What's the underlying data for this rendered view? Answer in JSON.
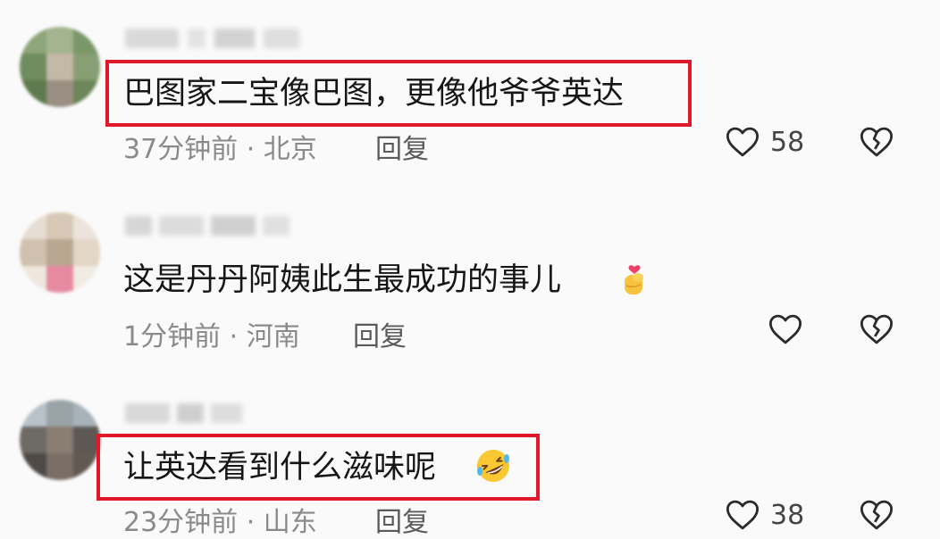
{
  "comments": [
    {
      "text": "巴图家二宝像巴图，更像他爷爷英达",
      "meta": "37分钟前 · 北京",
      "reply": "回复",
      "likes": "58",
      "highlighted": true,
      "emoji": null
    },
    {
      "text": "这是丹丹阿姨此生最成功的事儿",
      "meta": "1分钟前 · 河南",
      "reply": "回复",
      "likes": "",
      "highlighted": false,
      "emoji": "finger-heart-emoji"
    },
    {
      "text": "让英达看到什么滋味呢",
      "meta": "23分钟前 · 山东",
      "reply": "回复",
      "likes": "38",
      "highlighted": true,
      "emoji": "rolling-laughing-emoji"
    }
  ],
  "icons": {
    "like": "heart-outline-icon",
    "dislike": "broken-heart-icon"
  },
  "colors": {
    "highlight_border": "#e0182a",
    "meta_text": "#8a8a8a",
    "background": "#fafafa"
  }
}
